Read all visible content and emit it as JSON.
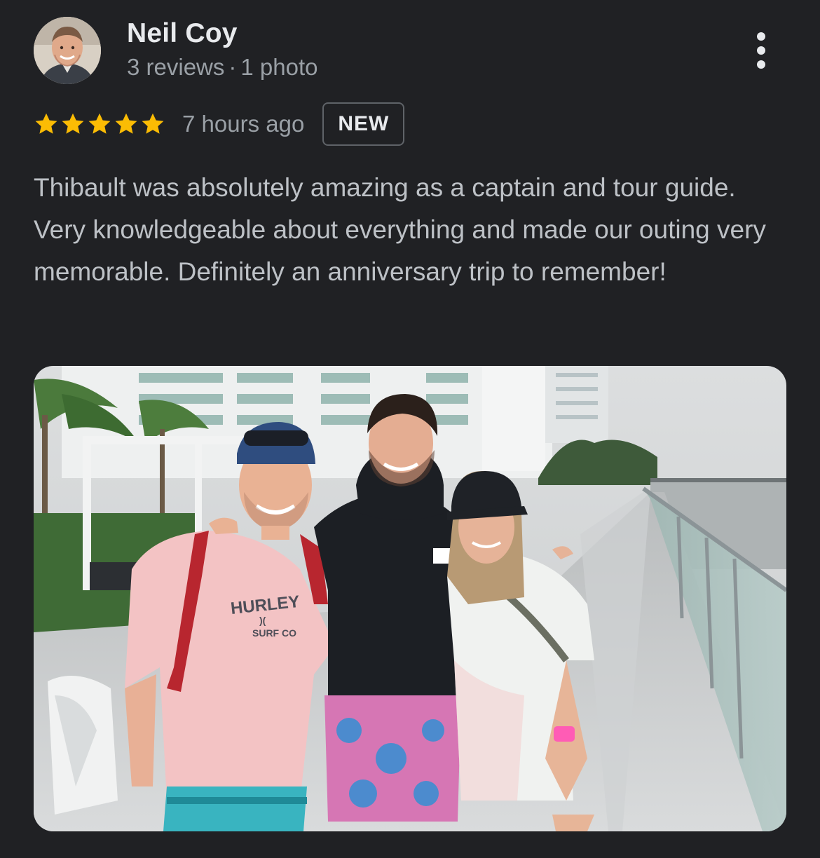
{
  "reviewer": {
    "name": "Neil Coy",
    "reviews": "3 reviews",
    "separator": "·",
    "photos": "1 photo"
  },
  "rating": {
    "stars": 5,
    "max": 5,
    "color": "#fbbc04"
  },
  "time_ago": "7 hours ago",
  "badge": "NEW",
  "review_text": "Thibault was absolutely amazing as a captain and tour guide. Very knowledgeable about everything and made our outing very memorable. Definitely an anniversary trip to remember!",
  "shirt": {
    "brand": "HURLEY",
    "sub": "SURF CO",
    "mark": ")("
  },
  "icons": {
    "more": "more-vert-icon",
    "star": "star-icon"
  }
}
